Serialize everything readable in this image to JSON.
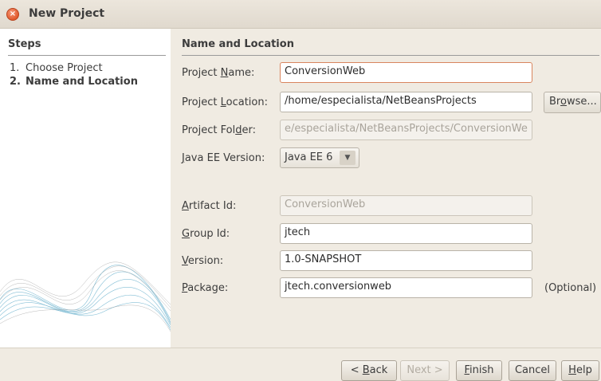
{
  "window": {
    "title": "New Project",
    "close_glyph": "×"
  },
  "steps": {
    "title": "Steps",
    "items": [
      {
        "num": "1.",
        "label": "Choose Project"
      },
      {
        "num": "2.",
        "label": "Name and Location"
      }
    ]
  },
  "panel": {
    "title": "Name and Location",
    "project_name": {
      "label_pre": "Project ",
      "label_mn": "N",
      "label_post": "ame:",
      "value": "ConversionWeb"
    },
    "project_location": {
      "label_pre": "Project ",
      "label_mn": "L",
      "label_post": "ocation:",
      "value": "/home/especialista/NetBeansProjects"
    },
    "browse": {
      "pre": "Br",
      "mn": "o",
      "post": "wse..."
    },
    "project_folder": {
      "label_pre": "Project Fol",
      "label_mn": "d",
      "label_post": "er:",
      "value": "e/especialista/NetBeansProjects/ConversionWe"
    },
    "javaee": {
      "label_pre": "",
      "label_mn": "J",
      "label_post": "ava EE Version:",
      "value": "Java EE 6",
      "arrow": "▼"
    },
    "artifact": {
      "label_pre": "",
      "label_mn": "A",
      "label_post": "rtifact Id:",
      "value": "ConversionWeb"
    },
    "group": {
      "label_pre": "",
      "label_mn": "G",
      "label_post": "roup Id:",
      "value": "jtech"
    },
    "version": {
      "label_pre": "",
      "label_mn": "V",
      "label_post": "ersion:",
      "value": "1.0-SNAPSHOT"
    },
    "package": {
      "label_pre": "",
      "label_mn": "P",
      "label_post": "ackage:",
      "value": "jtech.conversionweb"
    },
    "optional": "(Optional)"
  },
  "buttons": {
    "back": {
      "pre": "< ",
      "mn": "B",
      "post": "ack"
    },
    "next": "Next >",
    "finish": {
      "pre": "",
      "mn": "F",
      "post": "inish"
    },
    "cancel": "Cancel",
    "help": {
      "pre": "",
      "mn": "H",
      "post": "elp"
    }
  }
}
